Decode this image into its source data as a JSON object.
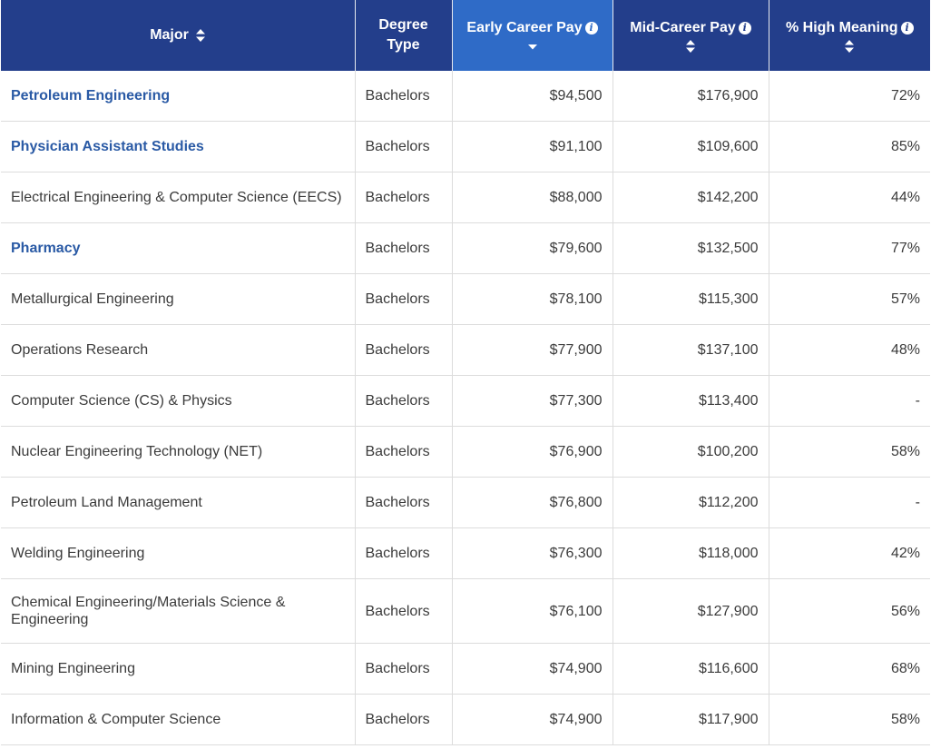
{
  "header": {
    "major": "Major",
    "degree_line1": "Degree",
    "degree_line2": "Type",
    "early": "Early Career Pay",
    "mid": "Mid-Career Pay",
    "meaning": "% High Meaning"
  },
  "colors": {
    "header_bg": "#233e8b",
    "sorted_header_bg": "#2f6bc7",
    "link": "#2a5aa5"
  },
  "rows": [
    {
      "major": "Petroleum Engineering",
      "link": true,
      "degree": "Bachelors",
      "early": "$94,500",
      "mid": "$176,900",
      "meaning": "72%"
    },
    {
      "major": "Physician Assistant Studies",
      "link": true,
      "degree": "Bachelors",
      "early": "$91,100",
      "mid": "$109,600",
      "meaning": "85%"
    },
    {
      "major": "Electrical Engineering & Computer Science (EECS)",
      "link": false,
      "degree": "Bachelors",
      "early": "$88,000",
      "mid": "$142,200",
      "meaning": "44%"
    },
    {
      "major": "Pharmacy",
      "link": true,
      "degree": "Bachelors",
      "early": "$79,600",
      "mid": "$132,500",
      "meaning": "77%"
    },
    {
      "major": "Metallurgical Engineering",
      "link": false,
      "degree": "Bachelors",
      "early": "$78,100",
      "mid": "$115,300",
      "meaning": "57%"
    },
    {
      "major": "Operations Research",
      "link": false,
      "degree": "Bachelors",
      "early": "$77,900",
      "mid": "$137,100",
      "meaning": "48%"
    },
    {
      "major": "Computer Science (CS) & Physics",
      "link": false,
      "degree": "Bachelors",
      "early": "$77,300",
      "mid": "$113,400",
      "meaning": "-"
    },
    {
      "major": "Nuclear Engineering Technology (NET)",
      "link": false,
      "degree": "Bachelors",
      "early": "$76,900",
      "mid": "$100,200",
      "meaning": "58%"
    },
    {
      "major": "Petroleum Land Management",
      "link": false,
      "degree": "Bachelors",
      "early": "$76,800",
      "mid": "$112,200",
      "meaning": "-"
    },
    {
      "major": "Welding Engineering",
      "link": false,
      "degree": "Bachelors",
      "early": "$76,300",
      "mid": "$118,000",
      "meaning": "42%"
    },
    {
      "major": "Chemical Engineering/Materials Science & Engineering",
      "link": false,
      "degree": "Bachelors",
      "early": "$76,100",
      "mid": "$127,900",
      "meaning": "56%"
    },
    {
      "major": "Mining Engineering",
      "link": false,
      "degree": "Bachelors",
      "early": "$74,900",
      "mid": "$116,600",
      "meaning": "68%"
    },
    {
      "major": "Information & Computer Science",
      "link": false,
      "degree": "Bachelors",
      "early": "$74,900",
      "mid": "$117,900",
      "meaning": "58%"
    }
  ]
}
